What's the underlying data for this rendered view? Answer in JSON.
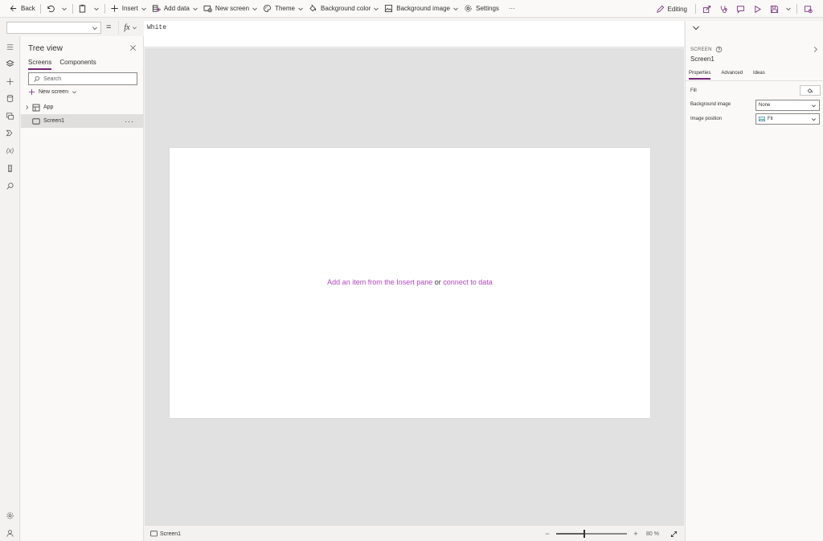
{
  "toolbar": {
    "back": "Back",
    "insert": "Insert",
    "add_data": "Add data",
    "new_screen": "New screen",
    "theme": "Theme",
    "background_color": "Background color",
    "background_image": "Background image",
    "settings": "Settings",
    "more": "···",
    "editing": "Editing"
  },
  "formula_bar": {
    "property": "",
    "equals": "=",
    "fx": "fx",
    "formula": "White"
  },
  "tree": {
    "title": "Tree view",
    "tabs": [
      "Screens",
      "Components"
    ],
    "search_placeholder": "Search",
    "new_screen": "New screen",
    "items": [
      {
        "label": "App"
      },
      {
        "label": "Screen1",
        "more": "···"
      }
    ]
  },
  "canvas": {
    "hint_part1": "Add an item from the Insert pane",
    "hint_or": " or ",
    "hint_link": "connect to data"
  },
  "status": {
    "screen": "Screen1",
    "zoom_minus": "−",
    "zoom_plus": "+",
    "zoom_value": "80",
    "zoom_unit": "%",
    "zoom_fraction": 0.4
  },
  "properties": {
    "kind": "SCREEN",
    "name": "Screen1",
    "tabs": [
      "Properties",
      "Advanced",
      "Ideas"
    ],
    "fill_label": "Fill",
    "bg_image_label": "Background image",
    "bg_image_value": "None",
    "image_position_label": "Image position",
    "image_position_value": "Fit"
  },
  "colors": {
    "accent": "#742774",
    "link": "#b146c2",
    "canvas_bg": "#e1e1e1"
  }
}
